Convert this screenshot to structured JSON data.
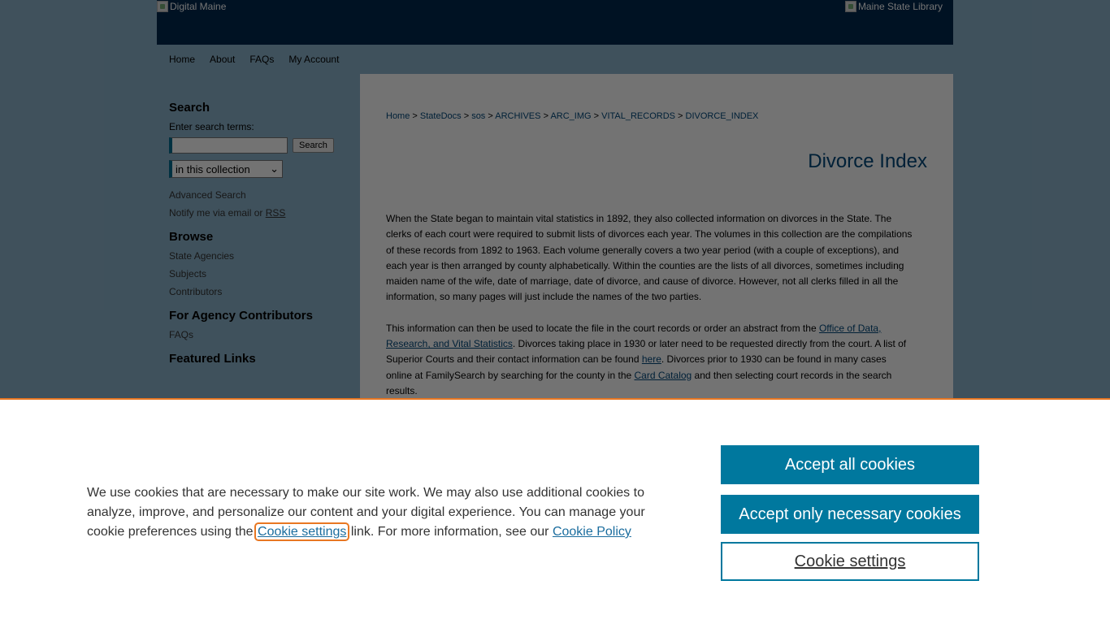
{
  "header": {
    "logo_left_alt": "Digital Maine",
    "logo_right_alt": "Maine State Library"
  },
  "topnav": {
    "items": [
      "Home",
      "About",
      "FAQs",
      "My Account"
    ]
  },
  "sidebar": {
    "search_heading": "Search",
    "search_label": "Enter search terms:",
    "search_button": "Search",
    "scope_selected": "in this collection",
    "advanced_search": "Advanced Search",
    "notify_prefix": "Notify me via email or",
    "notify_rss": "RSS",
    "browse_heading": "Browse",
    "browse_items": [
      "State Agencies",
      "Subjects",
      "Contributors"
    ],
    "agency_heading": "For Agency Contributors",
    "agency_items": [
      "FAQs"
    ],
    "featured_heading": "Featured Links"
  },
  "breadcrumb": {
    "items": [
      "Home",
      "StateDocs",
      "sos",
      "ARCHIVES",
      "ARC_IMG",
      "VITAL_RECORDS",
      "DIVORCE_INDEX"
    ],
    "separator": ">"
  },
  "content": {
    "title": "Divorce Index",
    "para1": "When the State began to maintain vital statistics in 1892, they also collected information on divorces in the State. The clerks of each court were required to submit lists of divorces each year. The volumes in this collection are the compilations of these records from 1892 to 1963. Each volume generally covers a two year period (with a couple of exceptions), and each year is then arranged by county alphabetically. Within the counties are the lists of all divorces, sometimes including maiden name of the wife, date of marriage, date of divorce, and cause of divorce. However, not all clerks filled in all the information, so many pages will just include the names of the two parties.",
    "para2_part1": "This information can then be used to locate the file in the court records or order an abstract from the ",
    "para2_link1": "Office of Data, Research, and Vital Statistics",
    "para2_part2": ". Divorces taking place in 1930 or later need to be requested directly from the court. A list of Superior Courts and their contact information can be found ",
    "para2_link2": "here",
    "para2_part3": ". Divorces prior to 1930 can be found in many cases online at FamilySearch by searching for the county in the ",
    "para2_link3": "Card Catalog",
    "para2_part4": " and then selecting court records in the search results."
  },
  "cookie_banner": {
    "text_part1": "We use cookies that are necessary to make our site work. We may also use additional cookies to analyze, improve, and personalize our content and your digital experience. You can manage your cookie preferences using the ",
    "settings_link": "Cookie settings",
    "text_part2": " link. For more information, see our ",
    "policy_link": "Cookie Policy",
    "accept_all": "Accept all cookies",
    "accept_necessary": "Accept only necessary cookies",
    "settings_button": "Cookie settings"
  },
  "colors": {
    "header_bg": "#00284f",
    "link": "#00477b",
    "button_primary": "#00789e",
    "banner_border": "#e87722"
  }
}
